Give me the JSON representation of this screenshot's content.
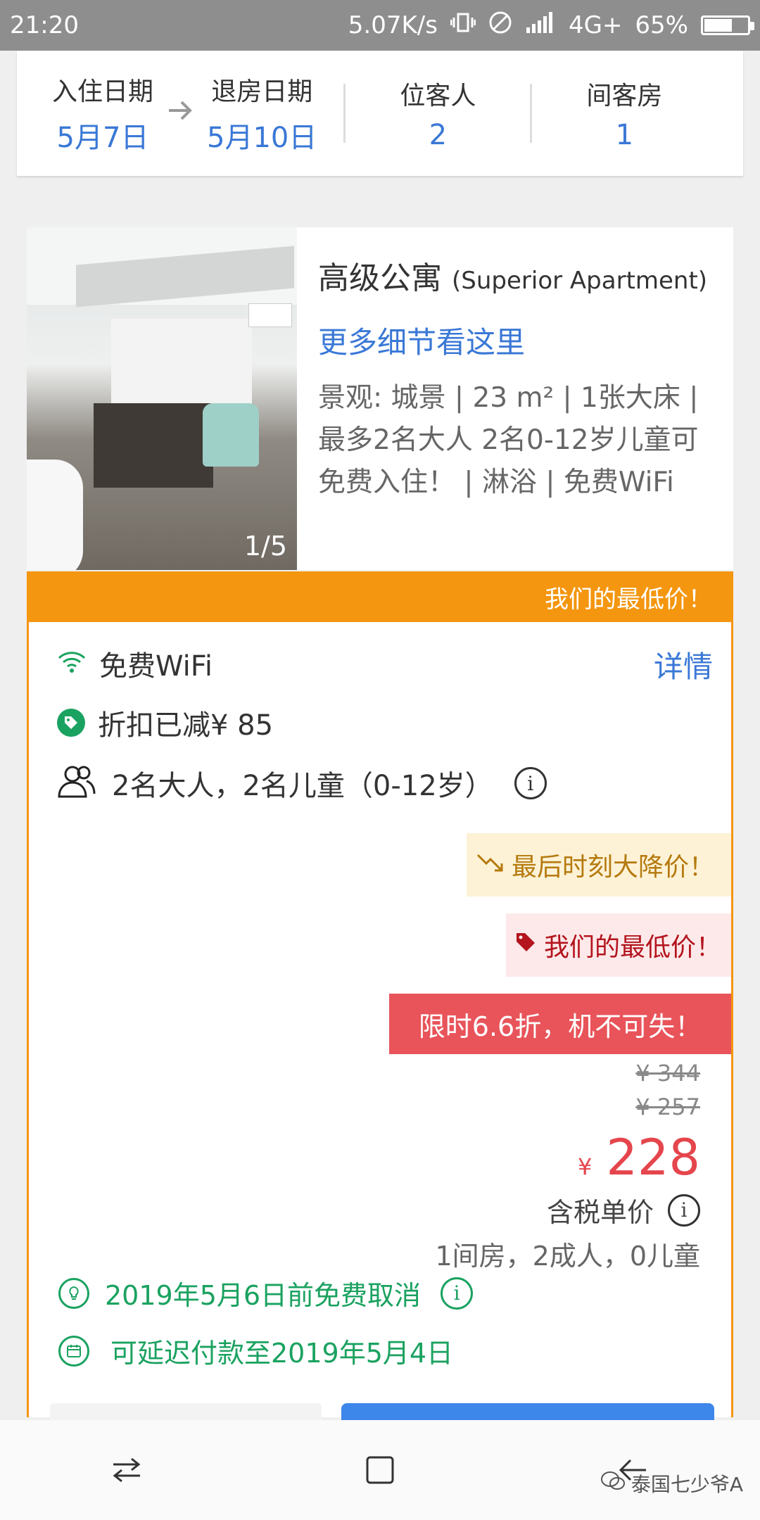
{
  "status_bar": {
    "time": "21:20",
    "speed": "5.07K/s",
    "network": "4G+",
    "battery": "65%",
    "battery_level": 0.65
  },
  "summary": {
    "checkin_label": "入住日期",
    "checkin_value": "5月7日",
    "checkout_label": "退房日期",
    "checkout_value": "5月10日",
    "guests_label": "位客人",
    "guests_value": "2",
    "rooms_label": "间客房",
    "rooms_value": "1"
  },
  "room": {
    "photo_counter": "1/5",
    "title": "高级公寓",
    "title_en": "(Superior Apartment)",
    "more_details": "更多细节看这里",
    "description": "景观: 城景 | 23 m² | 1张大床 | 最多2名大人 2名0-12岁儿童可免费入住！ | 淋浴 | 免费WiFi"
  },
  "band": {
    "text": "我们的最低价！"
  },
  "offer": {
    "wifi": "免费WiFi",
    "details_link": "详情",
    "discount": "折扣已减¥ 85",
    "occupancy_policy": "2名大人，2名儿童（0-12岁）",
    "badge_last_minute": "最后时刻大降价！",
    "badge_lowest": "我们的最低价！",
    "badge_sale": "限时6.6折，机不可失！",
    "price_original": "¥ 344",
    "price_before": "¥ 257",
    "price_currency": "¥",
    "price_final": "228",
    "tax_label": "含税单价",
    "occupancy_summary": "1间房，2成人，0儿童",
    "free_cancel": "2019年5月6日前免费取消",
    "pay_later": "可延迟付款至2019年5月4日"
  },
  "watermark": "泰国七少爷A",
  "colors": {
    "accent_blue": "#3a78d6",
    "orange": "#f4960f",
    "price_red": "#e5454c",
    "green": "#1aa260"
  }
}
